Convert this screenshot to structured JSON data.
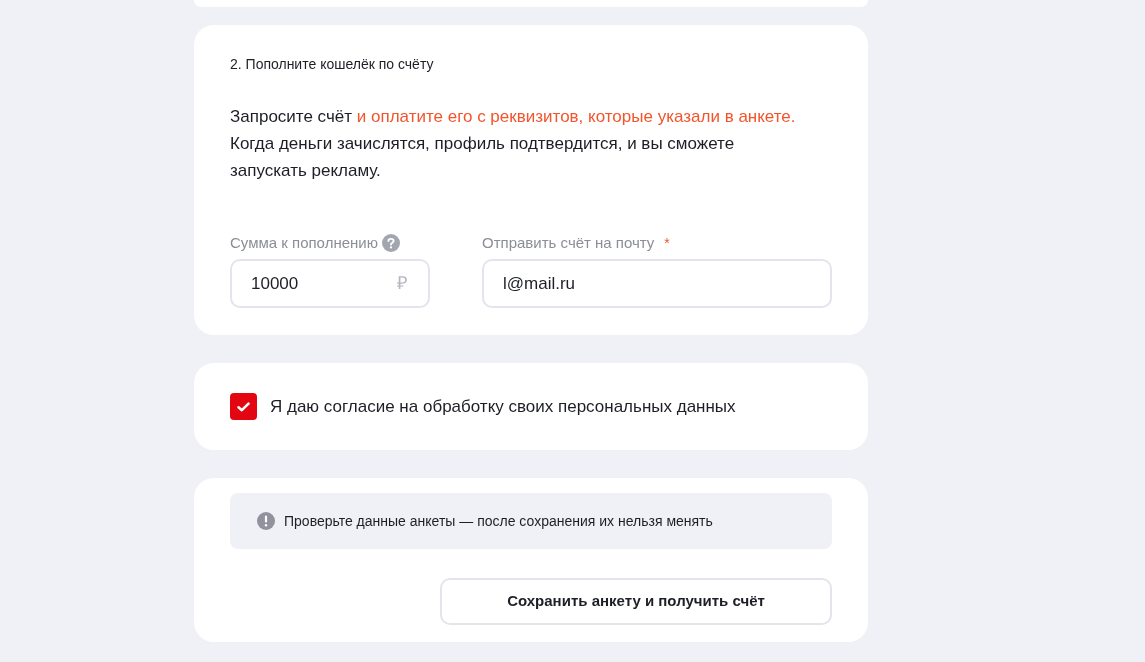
{
  "step_card": {
    "title": "2. Пополните кошелёк по счёту",
    "description": [
      {
        "text": "Запросите счёт",
        "highlight": false
      },
      {
        "text": "и оплатите его с реквизитов, которые указали в анкете.",
        "highlight": true
      },
      {
        "text": "Когда деньги зачислятся, профиль подтвердится, и вы сможете запускать рекламу.",
        "highlight": false
      }
    ],
    "fields": [
      {
        "kind": "amount",
        "label": "Сумма к пополнению",
        "help": true,
        "value": "10000",
        "suffix": "₽"
      },
      {
        "kind": "email",
        "label": "Отправить счёт на почту",
        "required_mark": "*",
        "value": "l@mail.ru"
      }
    ]
  },
  "consent": {
    "checked": true,
    "label": "Я даю согласие на обработку своих персональных данных"
  },
  "submit_card": {
    "notice": "Проверьте данные анкеты — после сохранения их нельзя менять",
    "button": "Сохранить анкету и получить счёт"
  }
}
